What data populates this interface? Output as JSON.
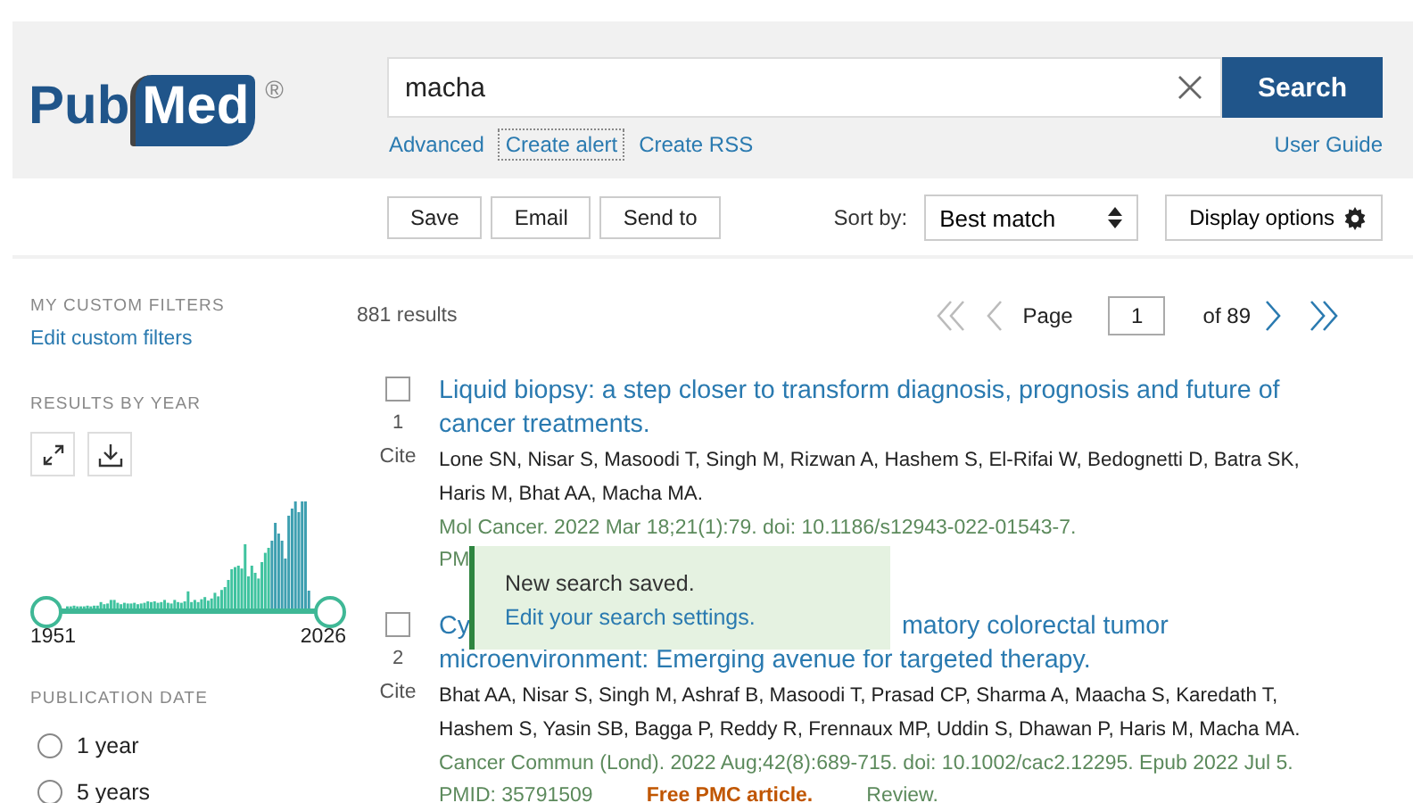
{
  "header": {
    "logo_pub": "Pub",
    "logo_med": "Med",
    "logo_mark": "®",
    "search": {
      "value": "macha"
    },
    "search_button": "Search",
    "links": [
      {
        "label": "Advanced",
        "focused": false
      },
      {
        "label": "Create alert",
        "focused": true
      },
      {
        "label": "Create RSS",
        "focused": false
      }
    ],
    "user_guide": "User Guide"
  },
  "toolbar": {
    "buttons": [
      "Save",
      "Email",
      "Send to"
    ],
    "sort_label": "Sort by:",
    "sort_value": "Best match",
    "display_options": "Display options"
  },
  "sidebar": {
    "custom_filters_heading": "MY CUSTOM FILTERS",
    "edit_filters": "Edit custom filters",
    "results_by_year_heading": "RESULTS BY YEAR",
    "year_range": [
      {
        "level": 0
      },
      {
        "level": 1
      }
    ],
    "year_start": "1951",
    "year_end": "2026",
    "publication_date_heading": "PUBLICATION DATE",
    "date_options": [
      {
        "label": "1 year",
        "selected": false
      },
      {
        "label": "5 years",
        "selected": false
      }
    ]
  },
  "results": {
    "count": "881 results",
    "pager": {
      "prev_enabled": false,
      "next_enabled": true,
      "page_label": "Page",
      "page": "1",
      "of": "of 89"
    },
    "items": [
      {
        "kind": "full",
        "checked": false,
        "number": "1",
        "cite": "Cite",
        "title": "Liquid biopsy: a step closer to transform diagnosis, prognosis and future of cancer treatments.",
        "authors": "Lone SN, Nisar S, Masoodi T, Singh M, Rizwan A, Hashem S, El-Rifai W, Bedognetti D, Batra SK, Haris M, Bhat AA, Macha MA.",
        "citation": "Mol Cancer. 2022 Mar 18;21(1):79. doi: 10.1186/s12943-022-01543-7.",
        "pmid": "PM"
      },
      {
        "kind": "covered",
        "checked": false,
        "number": "2",
        "cite": "Cite",
        "title_parts": [
          "Cy",
          "matory colorectal tumor",
          "microenvironment: Emerging avenue for targeted therapy."
        ],
        "authors": "Bhat AA, Nisar S, Singh M, Ashraf B, Masoodi T, Prasad CP, Sharma A, Maacha S, Karedath T, Hashem S, Yasin SB, Bagga P, Reddy R, Frennaux MP, Uddin S, Dhawan P, Haris M, Macha MA.",
        "citation": "Cancer Commun (Lond). 2022 Aug;42(8):689-715. doi: 10.1002/cac2.12295. Epub 2022 Jul 5.",
        "pmid": "PMID: 35791509",
        "free": "Free PMC article.",
        "type": "Review."
      }
    ]
  },
  "toast": {
    "text": "New search saved.",
    "link": "Edit your search settings."
  }
}
